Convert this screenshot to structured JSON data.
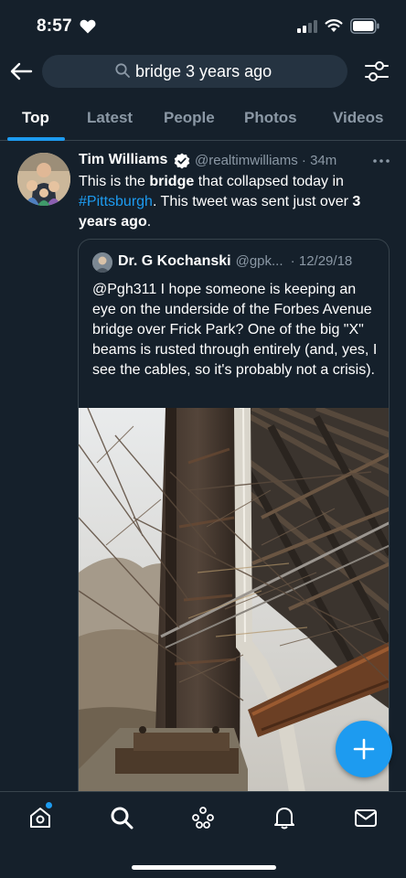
{
  "status_bar": {
    "time": "8:57"
  },
  "search": {
    "query": "bridge 3 years ago"
  },
  "tabs": [
    {
      "label": "Top",
      "active": true
    },
    {
      "label": "Latest",
      "active": false
    },
    {
      "label": "People",
      "active": false
    },
    {
      "label": "Photos",
      "active": false
    },
    {
      "label": "Videos",
      "active": false
    }
  ],
  "tweet": {
    "author_name": "Tim Williams",
    "author_handle": "@realtimwilliams",
    "time_ago": "34m",
    "text": {
      "p1": "This is the ",
      "bold1": "bridge",
      "p2": " that collapsed today in ",
      "hashtag": "#Pittsburgh",
      "p3": ". This tweet was sent just over ",
      "bold2": "3 years ago",
      "p4": "."
    },
    "quoted": {
      "author_name": "Dr. G Kochanski",
      "author_handle": "@gpk...",
      "date": "12/29/18",
      "text": "@Pgh311  I hope someone is keeping an eye on the underside of the Forbes Avenue bridge over Frick Park?  One of the big \"X\" beams is rusted through entirely (and, yes, I see the cables, so it's probably not a crisis)."
    }
  },
  "colors": {
    "background": "#15202b",
    "accent": "#1d9bf0",
    "secondary_text": "#8b98a5",
    "divider": "#38444d"
  },
  "icons": {
    "back": "arrow-left-icon",
    "search": "search-icon",
    "filter": "sliders-icon",
    "verified": "verified-badge-icon",
    "more": "more-horizontal-icon",
    "compose": "plus-icon",
    "nav": [
      "home-icon",
      "search-icon",
      "spaces-icon",
      "notifications-icon",
      "messages-icon"
    ]
  }
}
